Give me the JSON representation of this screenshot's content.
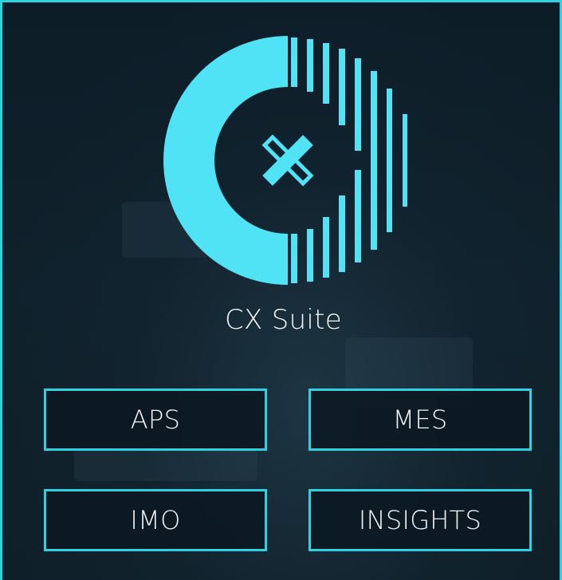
{
  "brand": {
    "name": "CX Suite",
    "logo_icon": "cx-logo-icon",
    "accent_color": "#4fe3f5",
    "border_color": "#2fd0e0"
  },
  "modules": [
    {
      "label": "APS"
    },
    {
      "label": "MES"
    },
    {
      "label": "IMO"
    },
    {
      "label": "INSIGHTS"
    }
  ]
}
